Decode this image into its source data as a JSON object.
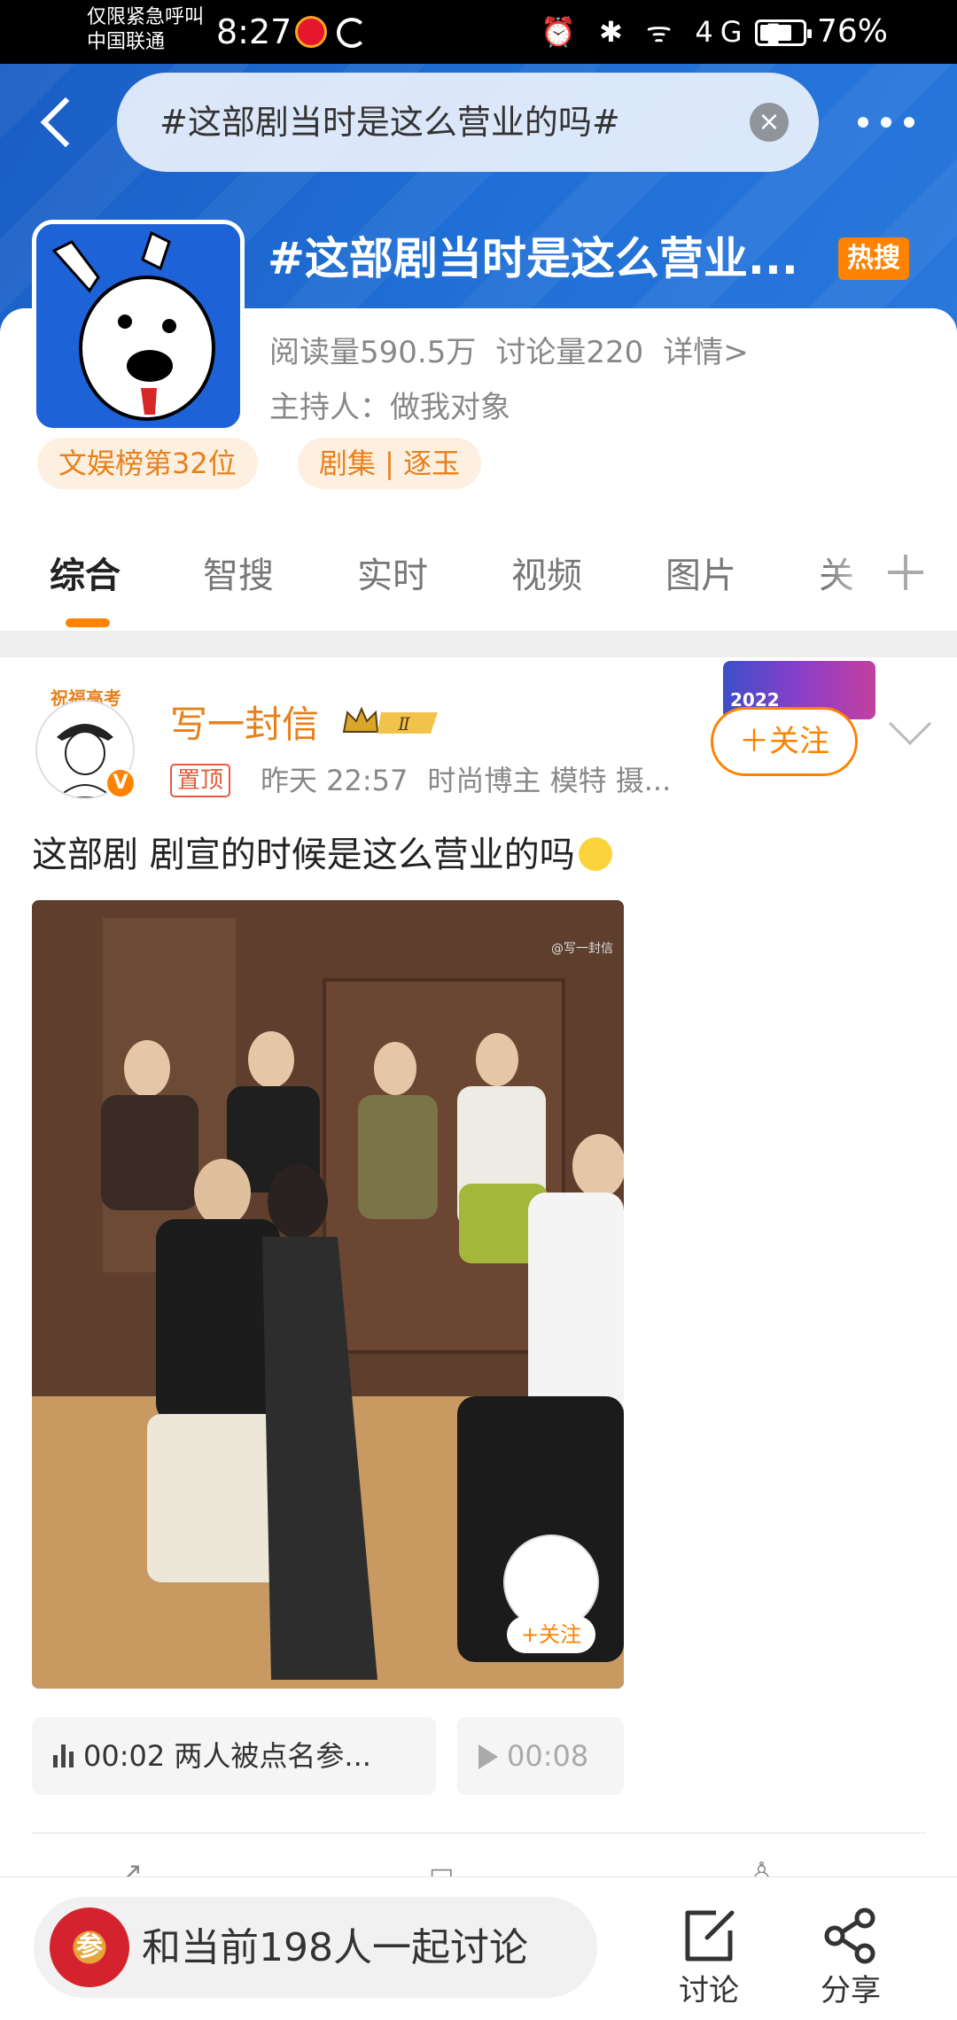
{
  "status_bar": {
    "carrier_line1": "仅限紧急呼叫",
    "carrier_line2": "中国联通",
    "time": "8:27",
    "icons": "⏰ ✱ ᯤ 4G ▮",
    "battery_level": 0.76,
    "battery_pct": "76%"
  },
  "header": {
    "search_value": "#这部剧当时是这么营业的吗#",
    "clear_icon": "close-icon"
  },
  "topic": {
    "title": "#这部剧当时是这么营业...",
    "hot_badge": "热搜",
    "reads": "阅读量590.5万",
    "discussions": "讨论量220",
    "details": "详情>",
    "host": "主持人：做我对象",
    "tags": [
      "文娱榜第32位",
      "剧集 | 逐玉"
    ]
  },
  "tabs": [
    "综合",
    "智搜",
    "实时",
    "视频",
    "图片",
    "关"
  ],
  "post": {
    "avatar_ribbon": "祝福高考",
    "author": "写一封信",
    "level_badge": "Ⅱ",
    "pinned": "置顶",
    "time": "昨天 22:57",
    "bio": "时尚博主 模特 摄...",
    "banner_year": "2022",
    "follow": "＋关注",
    "text": "这部剧 剧宣的时候是这么营业的吗",
    "video_watermark": "@写一封信",
    "video_follow": "+关注",
    "audio_items": [
      {
        "time": "00:02",
        "title": "两人被点名参..."
      },
      {
        "time": "00:08",
        "title": ""
      }
    ]
  },
  "bottom": {
    "discuss_logo": "参",
    "discuss_text": "和当前198人一起讨论",
    "discuss_btn": "讨论",
    "share_btn": "分享"
  },
  "colors": {
    "accent": "#ff8200",
    "hero_blue": "#1f6fd6",
    "tag_text": "#e8801a"
  }
}
